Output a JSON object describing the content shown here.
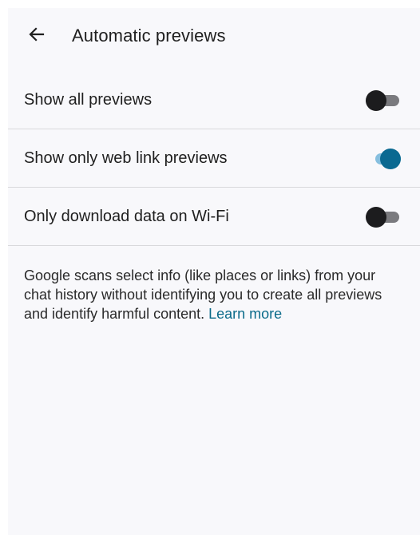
{
  "header": {
    "title": "Automatic previews",
    "back_icon": "arrow-left-icon"
  },
  "settings": [
    {
      "label": "Show all previews",
      "enabled": false
    },
    {
      "label": "Show only web link previews",
      "enabled": true
    },
    {
      "label": "Only download data on Wi-Fi",
      "enabled": false
    }
  ],
  "info": {
    "text": "Google scans select info (like places or links) from your chat history without identifying you to create all previews and identify harmful content. ",
    "link": "Learn more"
  },
  "colors": {
    "toggle_on_knob": "#0a6991",
    "toggle_on_track": "#86bfdf",
    "toggle_off_knob": "#1c1c1e",
    "toggle_off_track": "#7a7a7e",
    "link": "#0b6b8a"
  }
}
